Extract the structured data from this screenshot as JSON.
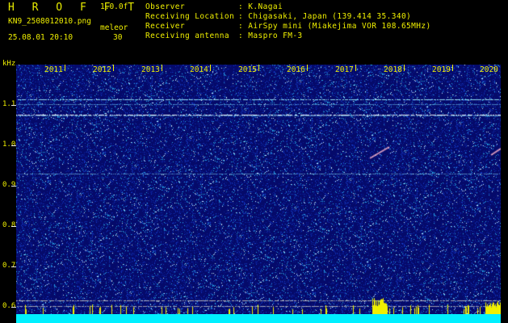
{
  "program": {
    "title": "H R O F F T",
    "version": "1.0.0f"
  },
  "file": {
    "name": "KN9_2508012010.png",
    "timestamp": "25.08.01 20:10"
  },
  "station": {
    "label": "meleor",
    "value": "30"
  },
  "info": {
    "labels": [
      "Observer",
      "Receiving Location",
      "Receiver",
      "Receiving antenna"
    ],
    "values": [
      ": K.Nagai",
      ": Chigasaki, Japan (139.414 35.340)",
      ": AirSpy mini (Miakejima VOR 108.65MHz)",
      ": Maspro FM-3"
    ]
  },
  "axis": {
    "unit": "kHz",
    "y_labels": [
      "1.1",
      "1.0",
      "0.9",
      "0.8",
      "0.7",
      "0.6"
    ],
    "year_labels": [
      "2011",
      "2012",
      "2013",
      "2014",
      "2015",
      "2016",
      "2017",
      "2018",
      "2019",
      "2020"
    ]
  },
  "colors": {
    "background": "#050a6a",
    "text": "#f0f000",
    "signal": "#00f0ff"
  }
}
